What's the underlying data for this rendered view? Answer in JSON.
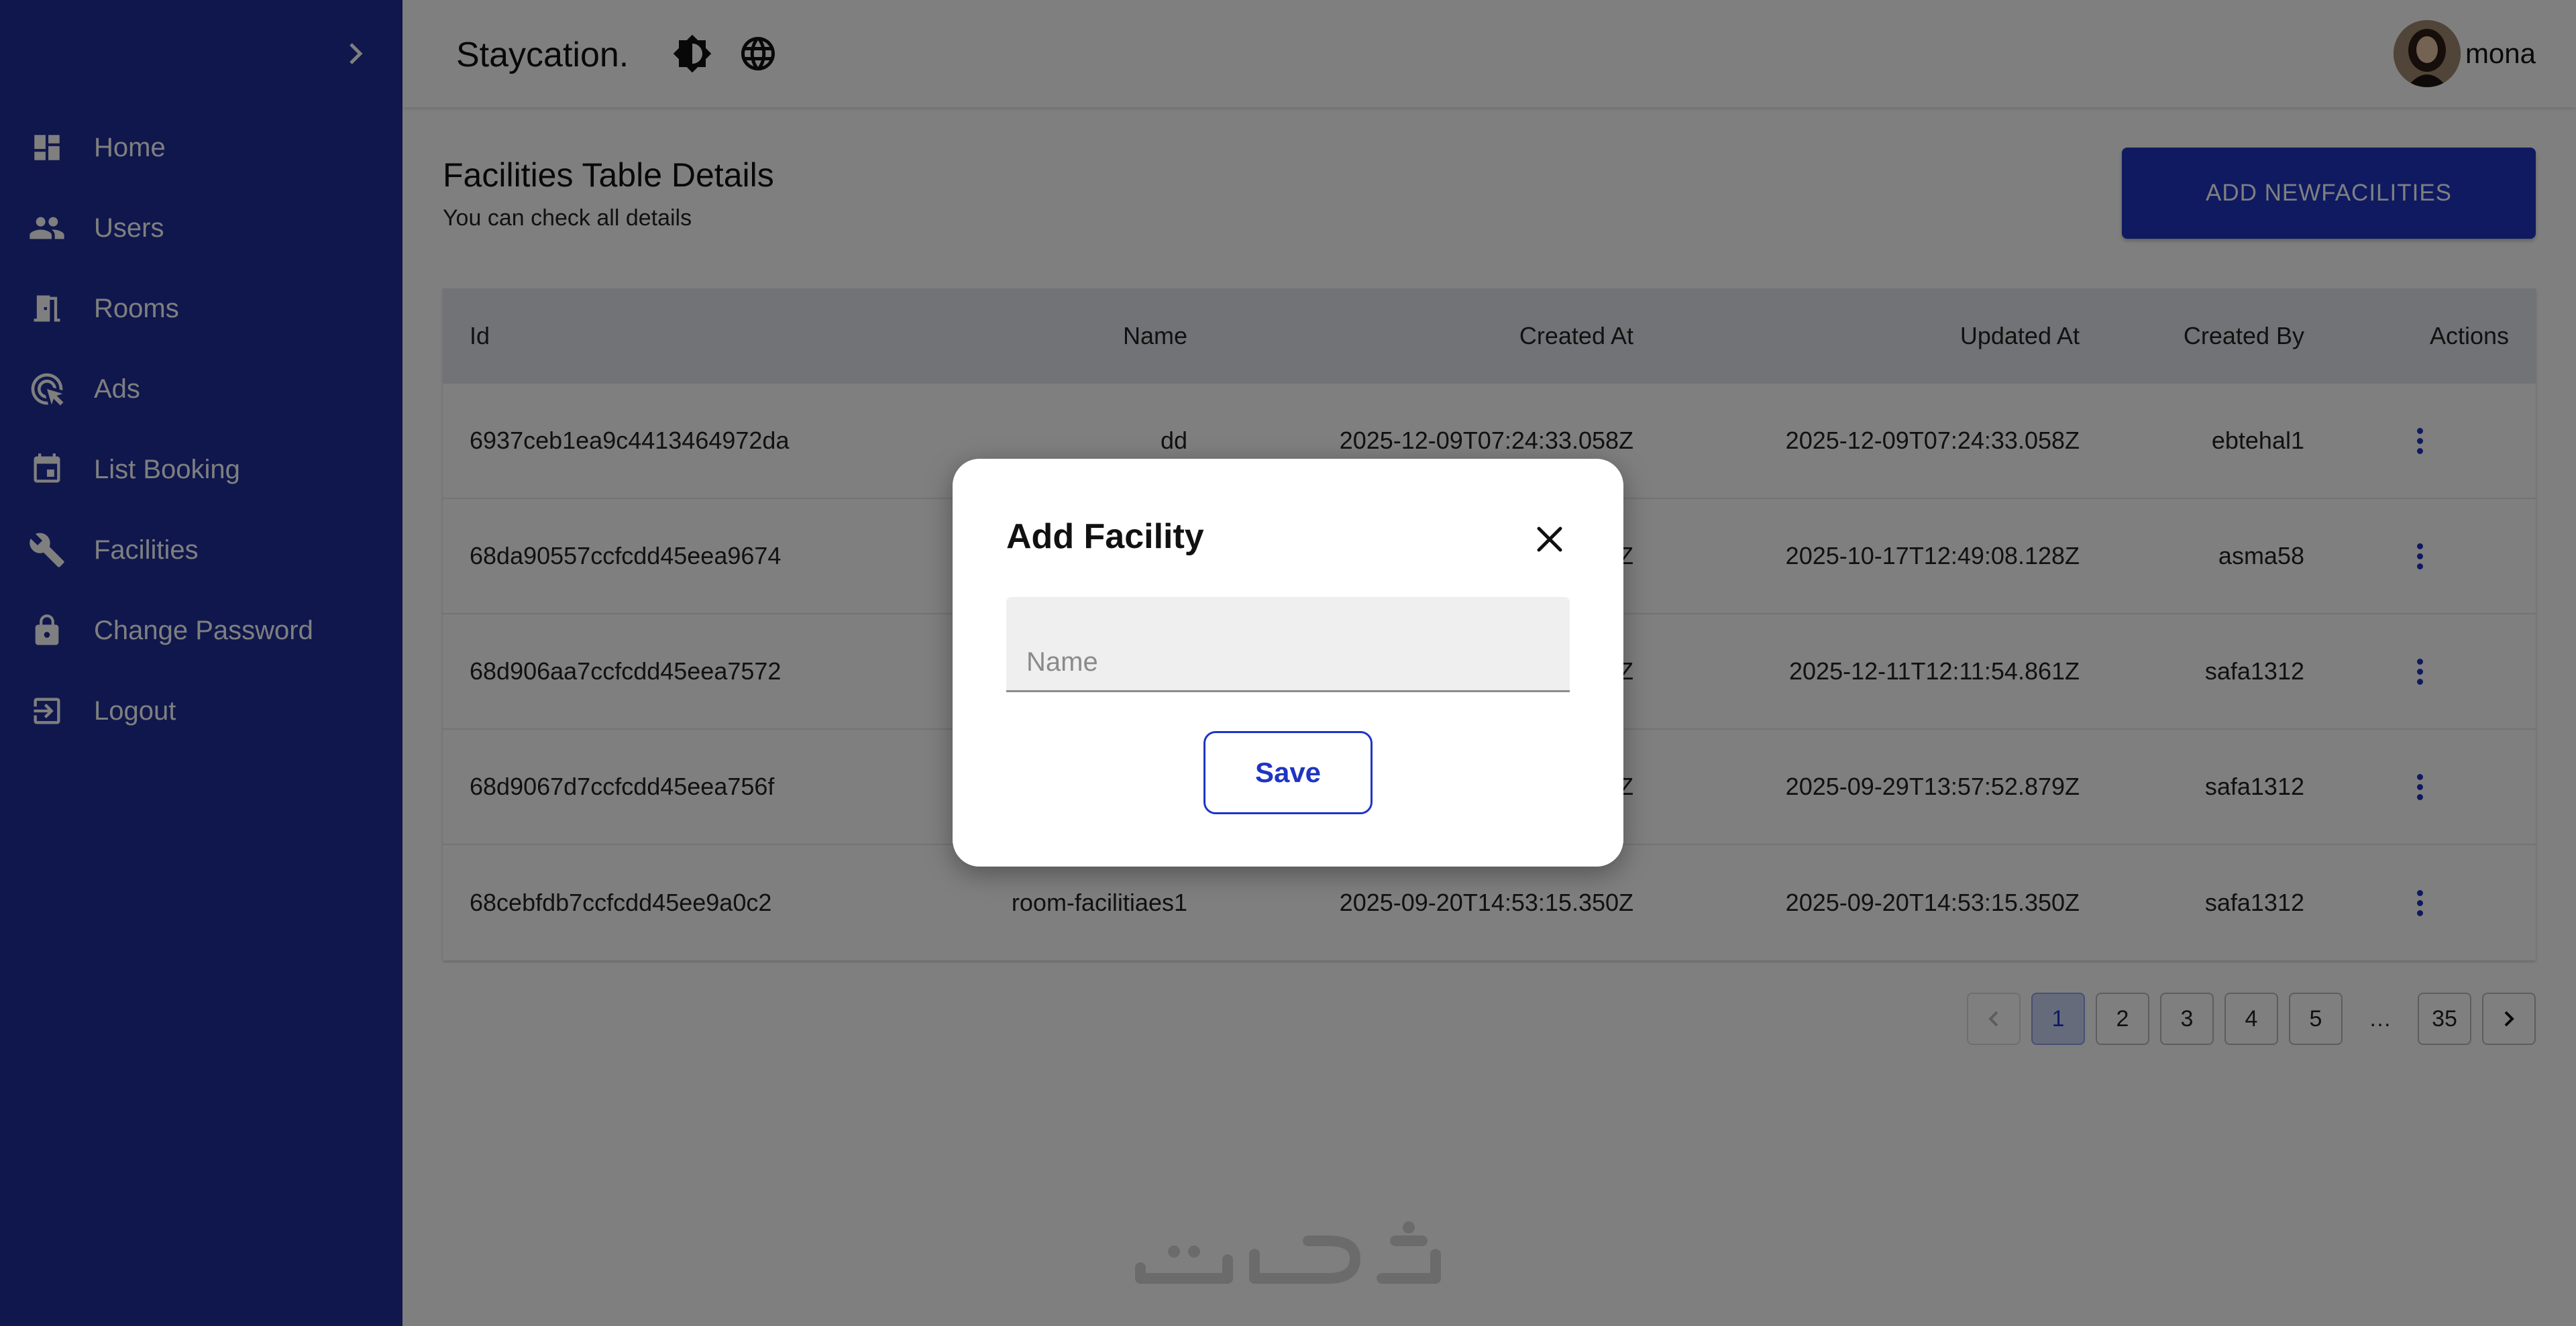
{
  "header": {
    "brand": "Staycation.",
    "username": "mona",
    "icons": [
      "theme-toggle-icon",
      "language-globe-icon"
    ]
  },
  "sidebar": {
    "collapse_icon": "chevron-right-icon",
    "items": [
      {
        "label": "Home",
        "icon": "dashboard-icon"
      },
      {
        "label": "Users",
        "icon": "people-icon"
      },
      {
        "label": "Rooms",
        "icon": "door-icon"
      },
      {
        "label": "Ads",
        "icon": "ads-click-icon"
      },
      {
        "label": "List Booking",
        "icon": "calendar-icon"
      },
      {
        "label": "Facilities",
        "icon": "wrench-icon"
      },
      {
        "label": "Change Password",
        "icon": "lock-icon"
      },
      {
        "label": "Logout",
        "icon": "logout-icon"
      }
    ]
  },
  "main": {
    "title": "Facilities Table Details",
    "subtitle": "You can check all details",
    "add_button": "ADD NEWFACILITIES",
    "table": {
      "headers": [
        "Id",
        "Name",
        "Created At",
        "Updated At",
        "Created By",
        "Actions"
      ],
      "rows": [
        {
          "id": "6937ceb1ea9c4413464972da",
          "name": "dd",
          "created": "2025-12-09T07:24:33.058Z",
          "updated": "2025-12-09T07:24:33.058Z",
          "by": "ebtehal1"
        },
        {
          "id": "68da90557ccfcdd45eea9674",
          "name": "",
          "created": "Z",
          "updated": "2025-10-17T12:49:08.128Z",
          "by": "asma58"
        },
        {
          "id": "68d906aa7ccfcdd45eea7572",
          "name": "",
          "created": "Z",
          "updated": "2025-12-11T12:11:54.861Z",
          "by": "safa1312"
        },
        {
          "id": "68d9067d7ccfcdd45eea756f",
          "name": "",
          "created": "Z",
          "updated": "2025-09-29T13:57:52.879Z",
          "by": "safa1312"
        },
        {
          "id": "68cebfdb7ccfcdd45ee9a0c2",
          "name": "room-facilitiaes1",
          "created": "2025-09-20T14:53:15.350Z",
          "updated": "2025-09-20T14:53:15.350Z",
          "by": "safa1312"
        }
      ]
    },
    "pagination": {
      "pages": [
        "1",
        "2",
        "3",
        "4",
        "5"
      ],
      "ellipsis": "…",
      "last": "35",
      "current": "1"
    }
  },
  "modal": {
    "title": "Add Facility",
    "name_placeholder": "Name",
    "name_value": "",
    "save_label": "Save"
  },
  "watermark": "خمسات",
  "colors": {
    "sidebar": "#1f2f9a",
    "primary": "#1f35c2",
    "overlay": "rgba(0,0,0,0.5)"
  }
}
